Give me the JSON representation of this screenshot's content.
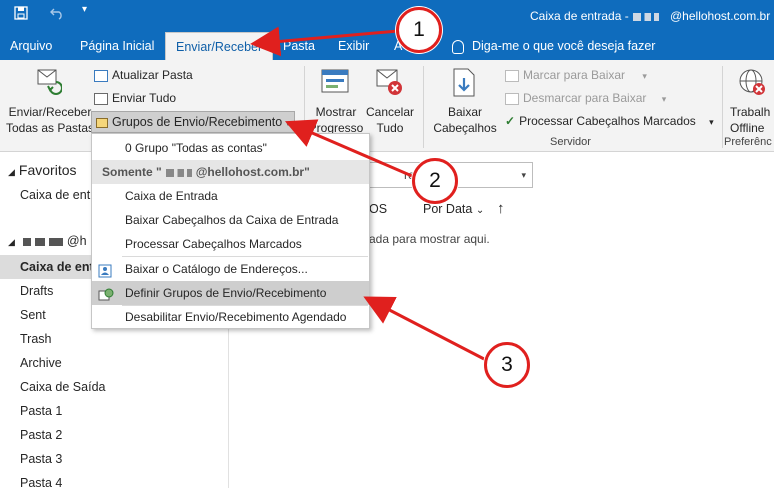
{
  "titlebar": {
    "title": "Caixa de entrada -",
    "account": "@hellohost.com.br"
  },
  "tabs": [
    "Arquivo",
    "Página Inicial",
    "Enviar/Receber",
    "Pasta",
    "Exibir",
    "A"
  ],
  "tell_me": "Diga-me o que você deseja fazer",
  "ribbon": {
    "send_receive_all": [
      "Enviar/Receber",
      "Todas as Pastas"
    ],
    "update_folder": "Atualizar Pasta",
    "send_all": "Enviar Tudo",
    "groups_button": "Grupos de Envio/Recebimento",
    "show_progress": [
      "Mostrar",
      "Progresso"
    ],
    "cancel_all": [
      "Cancelar",
      "Tudo"
    ],
    "download_headers": [
      "Baixar",
      "Cabeçalhos"
    ],
    "mark_download": "Marcar para Baixar",
    "unmark_download": "Desmarcar para Baixar",
    "process_marked_headers": "Processar Cabeçalhos Marcados",
    "server_group": "Servidor",
    "work_offline": [
      "Trabalh",
      "Offline"
    ],
    "preferences_group": "Preferênc",
    "download_group_partial": "ar"
  },
  "folders": {
    "favorites": "Favoritos",
    "fav_inbox": "Caixa de entra",
    "account_suffix": "@h",
    "items": [
      "Caixa de entr",
      "Drafts",
      "Sent",
      "Trash",
      "Archive",
      "Caixa de Saída",
      "Pasta 1",
      "Pasta 2",
      "Pasta 3",
      "Pasta 4"
    ]
  },
  "maillist": {
    "search_scope": "reio Atual",
    "os_label": "OS",
    "sort": "Por Data",
    "empty_msg": "ada para mostrar aqui."
  },
  "menu": {
    "items": [
      {
        "label": "0 Grupo \"Todas as contas\"",
        "type": "item"
      },
      {
        "label": "Somente \"",
        "suffix": "@hellohost.com.br\"",
        "type": "header"
      },
      {
        "label": "Caixa de Entrada",
        "type": "item"
      },
      {
        "label": "Baixar Cabeçalhos da Caixa de Entrada",
        "type": "item"
      },
      {
        "label": "Processar Cabeçalhos Marcados",
        "type": "item"
      },
      {
        "label": "Baixar o Catálogo de Endereços...",
        "type": "item"
      },
      {
        "label": "Definir Grupos de Envio/Recebimento",
        "type": "item-hot"
      },
      {
        "label": "Desabilitar Envio/Recebimento Agendado",
        "type": "item"
      }
    ]
  },
  "annotations": [
    "1",
    "2",
    "3"
  ],
  "colors": {
    "brand": "#0f6cbd",
    "annotation": "#e0201e"
  }
}
